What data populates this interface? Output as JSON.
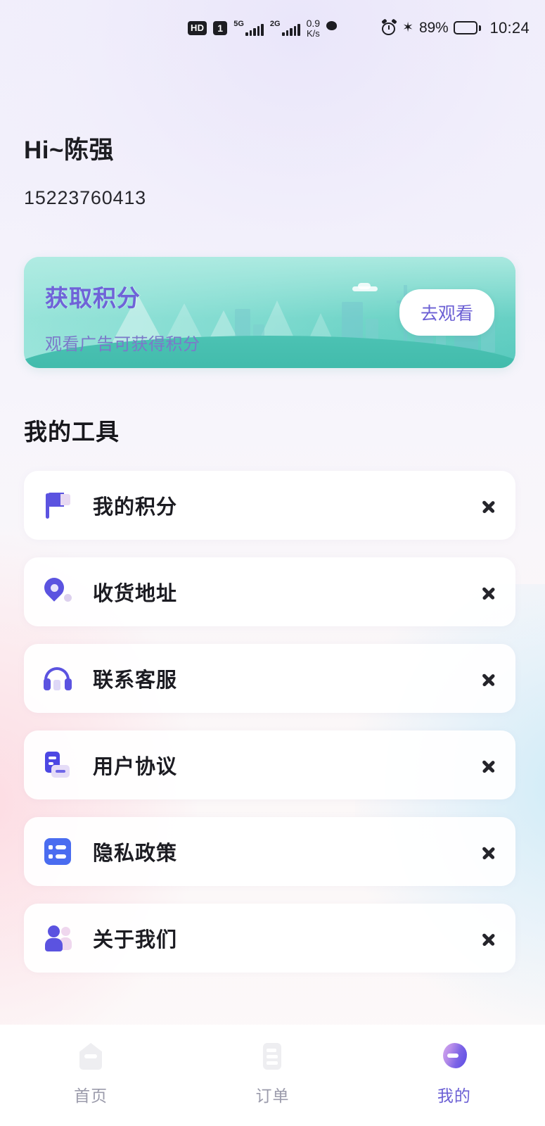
{
  "status_bar": {
    "hd_label": "HD",
    "sim_label": "1",
    "network_1": "5G",
    "network_2": "2G",
    "net_speed_value": "0.9",
    "net_speed_unit": "K/s",
    "wechat_icon": "wechat-icon",
    "alarm_icon": "alarm-icon",
    "bluetooth_icon": "bluetooth-icon",
    "battery_percent": "89%",
    "time": "10:24"
  },
  "profile": {
    "greeting": "Hi~陈强",
    "phone": "15223760413"
  },
  "banner": {
    "title": "获取积分",
    "subtitle": "观看广告可获得积分",
    "button_label": "去观看",
    "accent_color": "#6f63d8",
    "bg_color_start": "#9fe6dc",
    "bg_color_end": "#57c9bd"
  },
  "tools": {
    "section_title": "我的工具",
    "items": [
      {
        "label": "我的积分",
        "icon": "flag-icon"
      },
      {
        "label": "收货地址",
        "icon": "location-pin-icon"
      },
      {
        "label": "联系客服",
        "icon": "headphones-icon"
      },
      {
        "label": "用户协议",
        "icon": "document-icon"
      },
      {
        "label": "隐私政策",
        "icon": "list-icon"
      },
      {
        "label": "关于我们",
        "icon": "person-icon"
      }
    ],
    "chevron_icon": "chevron-right-icon"
  },
  "tabbar": {
    "items": [
      {
        "label": "首页",
        "icon": "home-icon",
        "active": false
      },
      {
        "label": "订单",
        "icon": "orders-icon",
        "active": false
      },
      {
        "label": "我的",
        "icon": "profile-icon",
        "active": true
      }
    ],
    "active_color": "#6b5fd4",
    "inactive_color": "#9b9bab"
  }
}
